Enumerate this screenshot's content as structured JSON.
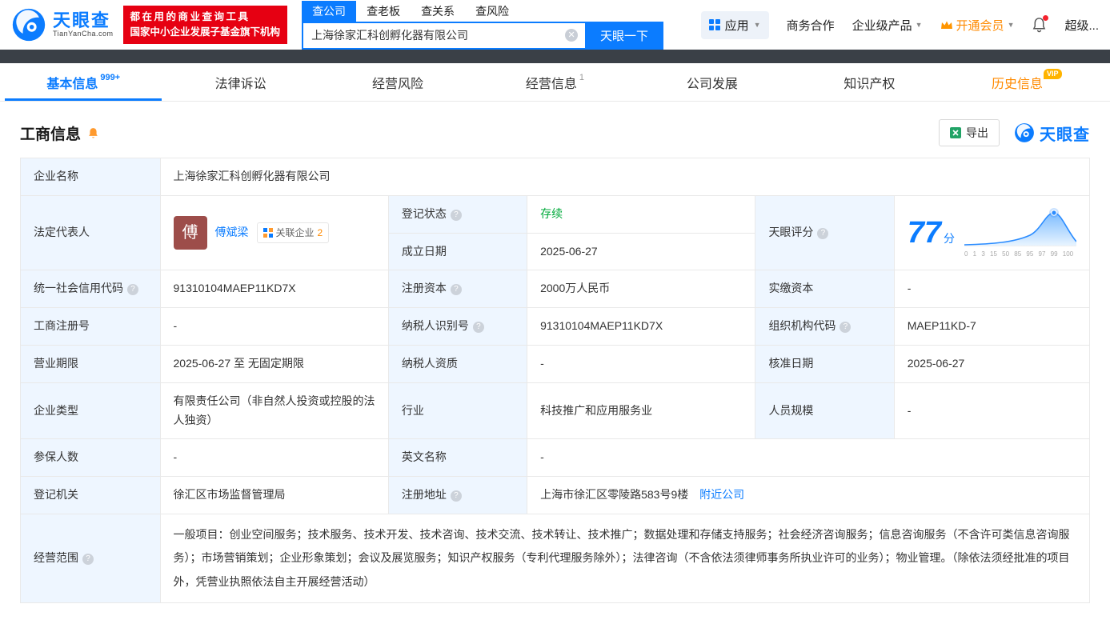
{
  "colors": {
    "primary": "#0b7cff",
    "status_green": "#00aa3b",
    "vip_orange": "#ff8a00",
    "badge_red": "#e60012",
    "label_bg": "#eef6ff"
  },
  "header": {
    "brand": "天眼查",
    "brand_domain": "TianYanCha.com",
    "slogan_line1": "都在用的商业查询工具",
    "slogan_line2": "国家中小企业发展子基金旗下机构",
    "search_tabs": {
      "company": "查公司",
      "boss": "查老板",
      "relation": "查关系",
      "risk": "查风险"
    },
    "search_value": "上海徐家汇科创孵化器有限公司",
    "search_button": "天眼一下",
    "nav_app": "应用",
    "nav_cooperation": "商务合作",
    "nav_enterprise": "企业级产品",
    "nav_vip": "开通会员",
    "nav_user": "超级..."
  },
  "tabs": {
    "basic": {
      "label": "基本信息",
      "badge": "999+"
    },
    "legal": {
      "label": "法律诉讼"
    },
    "risk": {
      "label": "经营风险"
    },
    "operation": {
      "label": "经营信息",
      "badge": "1"
    },
    "development": {
      "label": "公司发展"
    },
    "ip": {
      "label": "知识产权"
    },
    "history": {
      "label": "历史信息",
      "vip_badge": "VIP"
    }
  },
  "section": {
    "title": "工商信息",
    "export_label": "导出",
    "brand_watermark": "天眼查"
  },
  "biz": {
    "company_name": {
      "label": "企业名称",
      "value": "上海徐家汇科创孵化器有限公司"
    },
    "legal_rep": {
      "label": "法定代表人",
      "avatar": "傅",
      "name": "傅斌梁",
      "related_label": "关联企业",
      "related_count": "2"
    },
    "reg_status": {
      "label": "登记状态",
      "value": "存续"
    },
    "establish_date": {
      "label": "成立日期",
      "value": "2025-06-27"
    },
    "score": {
      "label": "天眼评分",
      "value": "77",
      "unit": "分",
      "axis": "0 1 3 15 50 85 95 97 99 100"
    },
    "credit_code": {
      "label": "统一社会信用代码",
      "value": "91310104MAEP11KD7X"
    },
    "reg_capital": {
      "label": "注册资本",
      "value": "2000万人民币"
    },
    "paid_capital": {
      "label": "实缴资本",
      "value": "-"
    },
    "reg_number": {
      "label": "工商注册号",
      "value": "-"
    },
    "taxpayer_id": {
      "label": "纳税人识别号",
      "value": "91310104MAEP11KD7X"
    },
    "org_code": {
      "label": "组织机构代码",
      "value": "MAEP11KD-7"
    },
    "business_term": {
      "label": "营业期限",
      "value": "2025-06-27 至 无固定期限"
    },
    "taxpayer_quality": {
      "label": "纳税人资质",
      "value": "-"
    },
    "approval_date": {
      "label": "核准日期",
      "value": "2025-06-27"
    },
    "company_type": {
      "label": "企业类型",
      "value": "有限责任公司（非自然人投资或控股的法人独资）"
    },
    "industry": {
      "label": "行业",
      "value": "科技推广和应用服务业"
    },
    "staff_size": {
      "label": "人员规模",
      "value": "-"
    },
    "insured_count": {
      "label": "参保人数",
      "value": "-"
    },
    "english_name": {
      "label": "英文名称",
      "value": "-"
    },
    "reg_authority": {
      "label": "登记机关",
      "value": "徐汇区市场监督管理局"
    },
    "reg_address": {
      "label": "注册地址",
      "value": "上海市徐汇区零陵路583号9楼",
      "nearby": "附近公司"
    },
    "business_scope": {
      "label": "经营范围",
      "value": "一般项目：创业空间服务；技术服务、技术开发、技术咨询、技术交流、技术转让、技术推广；数据处理和存储支持服务；社会经济咨询服务；信息咨询服务（不含许可类信息咨询服务）；市场营销策划；企业形象策划；会议及展览服务；知识产权服务（专利代理服务除外）；法律咨询（不含依法须律师事务所执业许可的业务）；物业管理。（除依法须经批准的项目外，凭营业执照依法自主开展经营活动）"
    }
  }
}
